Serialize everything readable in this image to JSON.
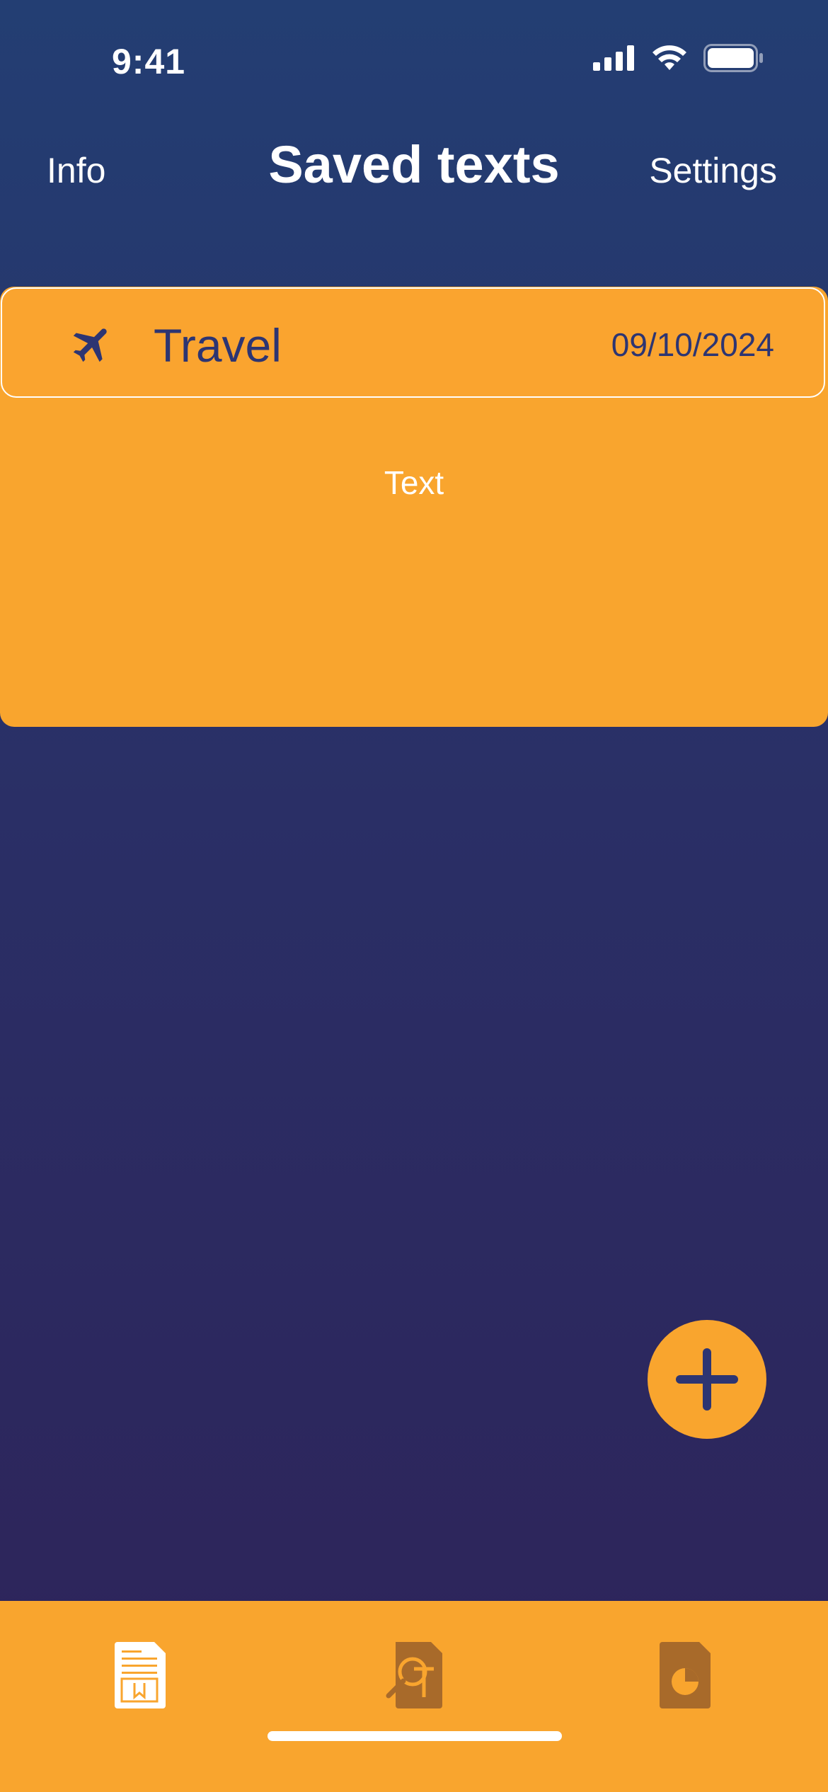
{
  "status_bar": {
    "time": "9:41",
    "icons": [
      "cellular-signal-icon",
      "wifi-icon",
      "battery-icon"
    ]
  },
  "nav": {
    "left_label": "Info",
    "title": "Saved texts",
    "right_label": "Settings"
  },
  "saved_texts": [
    {
      "icon": "airplane-icon",
      "title": "Travel",
      "date": "09/10/2024",
      "body": "Text"
    }
  ],
  "fab": {
    "icon": "plus-icon"
  },
  "tab_bar": {
    "tabs": [
      {
        "icon": "saved-document-icon",
        "active": true
      },
      {
        "icon": "text-search-document-icon",
        "active": false
      },
      {
        "icon": "report-chart-document-icon",
        "active": false
      }
    ]
  },
  "colors": {
    "background_top": "#233e73",
    "background_bottom": "#2e2359",
    "accent": "#f9a52e",
    "dark_text": "#2d3572",
    "inactive_tab_icon": "#a86a2a"
  }
}
